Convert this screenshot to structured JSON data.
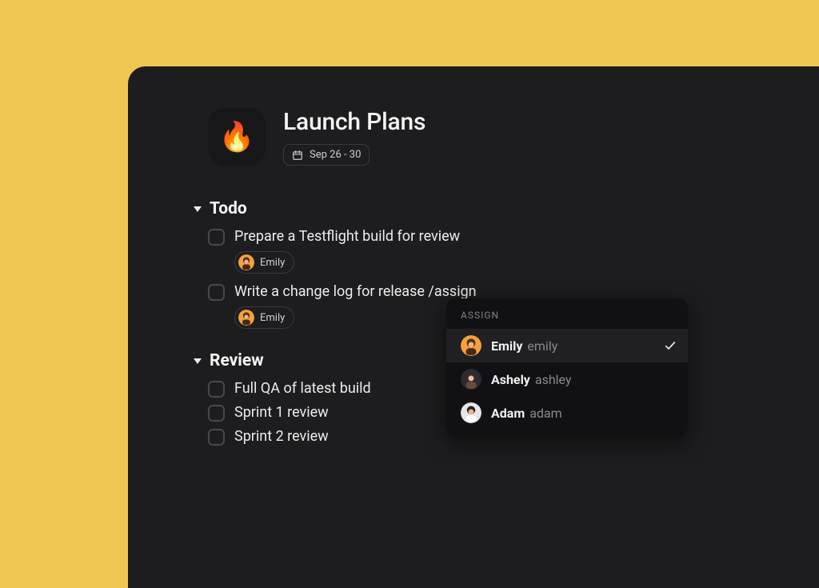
{
  "page": {
    "icon": "🔥",
    "title": "Launch Plans",
    "date_range": "Sep 26 - 30"
  },
  "sections": {
    "todo": {
      "title": "Todo",
      "tasks": [
        {
          "title": "Prepare a Testflight build for review",
          "assignee": "Emily"
        },
        {
          "title": "Write a change log for release /assign",
          "assignee": "Emily"
        }
      ]
    },
    "review": {
      "title": "Review",
      "tasks": [
        {
          "title": "Full QA of latest build"
        },
        {
          "title": "Sprint 1 review"
        },
        {
          "title": "Sprint 2 review"
        }
      ]
    }
  },
  "assign_popover": {
    "label": "ASSIGN",
    "options": [
      {
        "display": "Emily",
        "handle": "emily",
        "selected": true
      },
      {
        "display": "Ashely",
        "handle": "ashley",
        "selected": false
      },
      {
        "display": "Adam",
        "handle": "adam",
        "selected": false
      }
    ]
  }
}
